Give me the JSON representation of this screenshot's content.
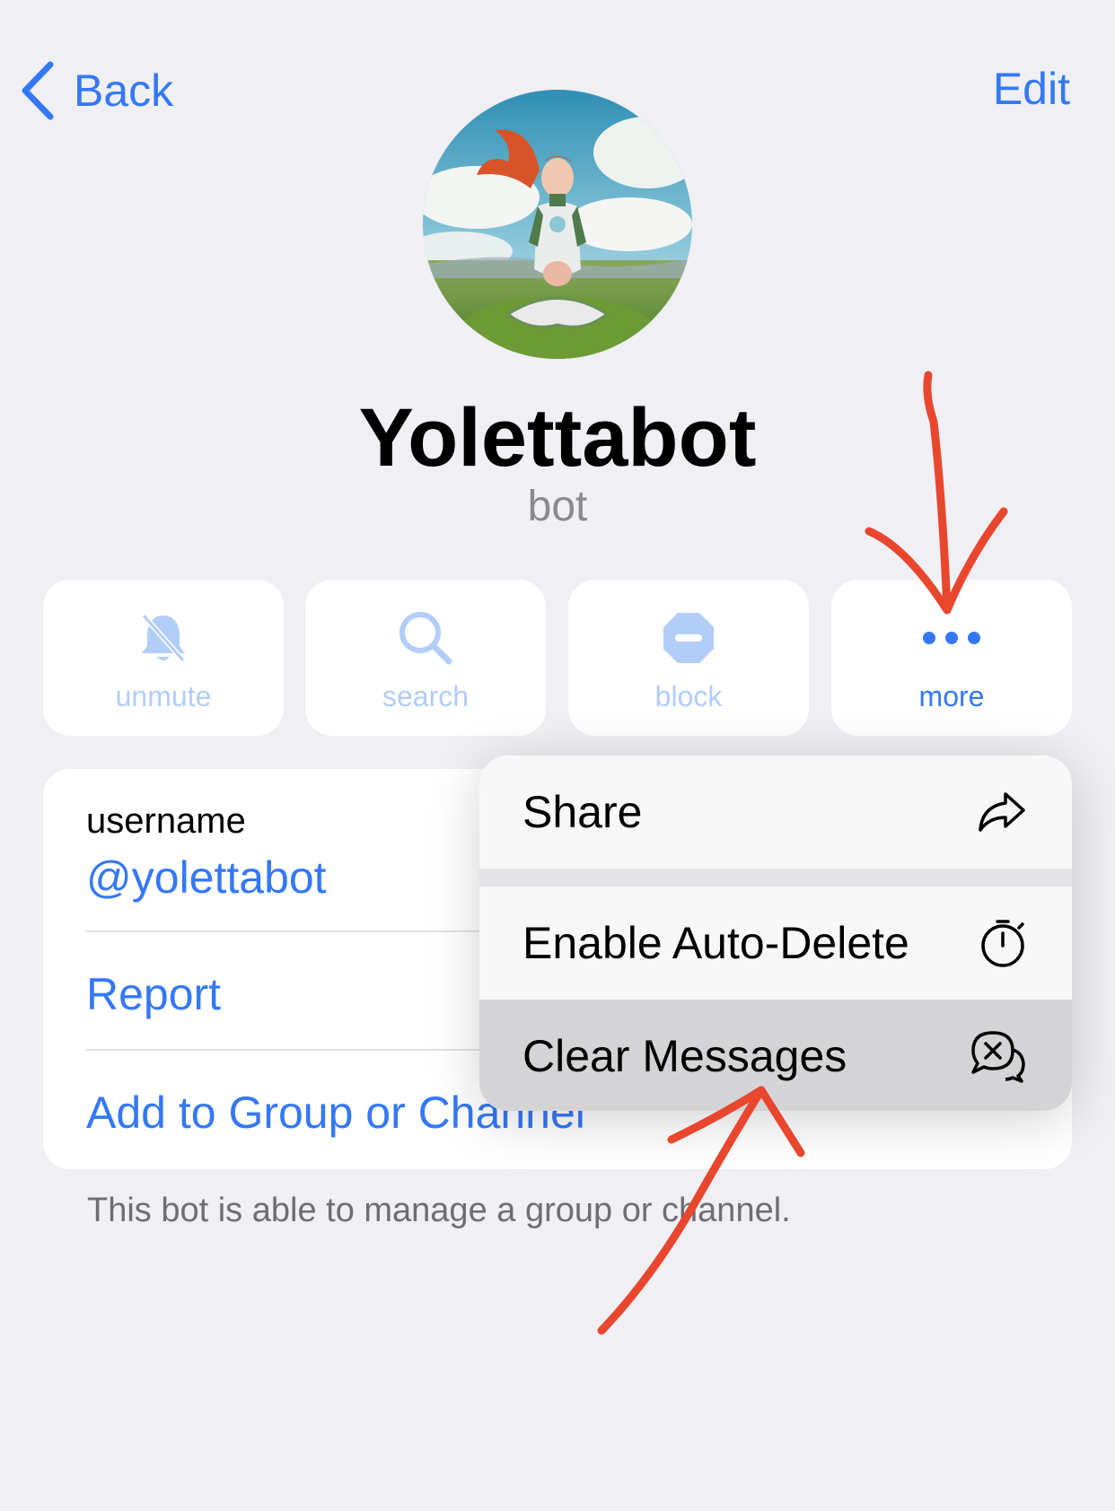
{
  "nav": {
    "back_label": "Back",
    "edit_label": "Edit"
  },
  "profile": {
    "name": "Yolettabot",
    "subtitle": "bot"
  },
  "actions": [
    {
      "label": "unmute",
      "icon": "bell-slash-icon",
      "state": "dimmed"
    },
    {
      "label": "search",
      "icon": "search-icon",
      "state": "dimmed"
    },
    {
      "label": "block",
      "icon": "block-icon",
      "state": "dimmed"
    },
    {
      "label": "more",
      "icon": "more-dots-icon",
      "state": "active"
    }
  ],
  "info": {
    "username_label": "username",
    "username_value": "@yolettabot",
    "report_label": "Report",
    "add_group_label": "Add to Group or Channel"
  },
  "footnote": "This bot is able to manage a group or channel.",
  "menu": {
    "items": [
      {
        "label": "Share",
        "icon": "share-arrow-icon"
      },
      {
        "label": "Enable Auto-Delete",
        "icon": "timer-icon"
      },
      {
        "label": "Clear Messages",
        "icon": "clear-chat-icon",
        "highlighted": true
      }
    ]
  },
  "colors": {
    "accent": "#3478f6",
    "accent_dim": "#b3cdf9",
    "background": "#efeff4",
    "annotation": "#e8472e"
  }
}
